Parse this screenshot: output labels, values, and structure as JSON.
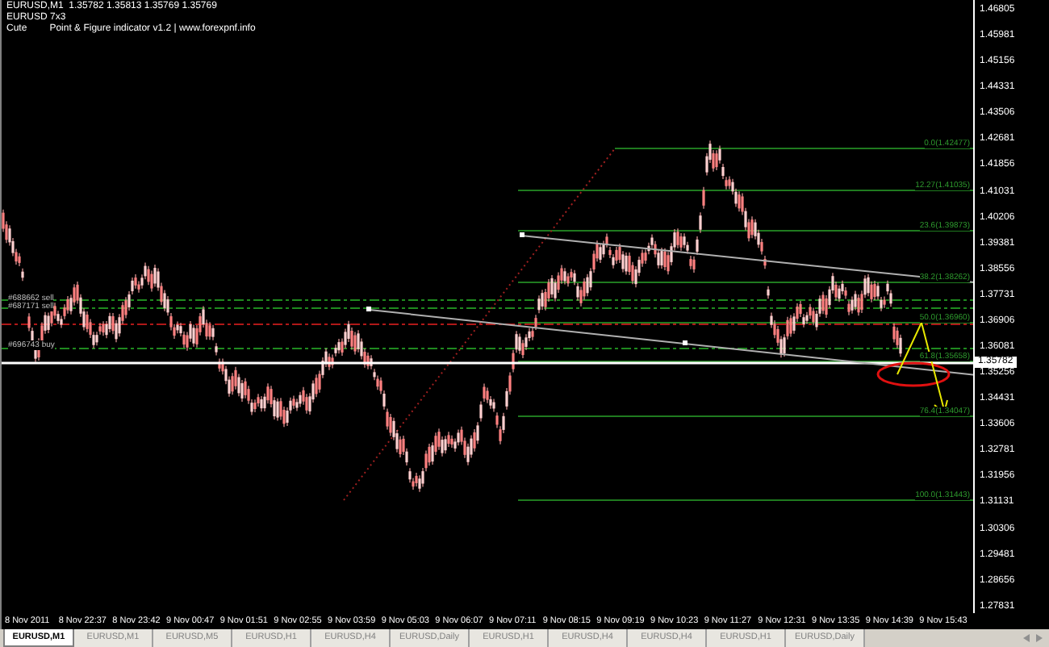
{
  "header": {
    "symbol_line": "EURUSD,M1  1.35782 1.35813 1.35769 1.35769",
    "subtitle": "EURUSD 7x3",
    "indicator_name": "Cute",
    "indicator_info": "Point & Figure indicator v1.2 | www.forexpnf.info"
  },
  "order_labels": [
    "#688662 sell",
    "#687171 sell",
    "#696743 buy"
  ],
  "fib_levels": [
    "0.0(1.42477)",
    "12.27(1.41035)",
    "23.6(1.39873)",
    "38.2(1.38262)",
    "50.0(1.36960)",
    "61.8(1.35658)",
    "76.4(1.34047)",
    "100.0(1.31443)"
  ],
  "price_axis": [
    "1.46805",
    "1.45981",
    "1.45156",
    "1.44331",
    "1.43506",
    "1.42681",
    "1.41856",
    "1.41031",
    "1.40206",
    "1.39381",
    "1.38556",
    "1.37731",
    "1.36906",
    "1.36081",
    "1.35256",
    "1.34431",
    "1.33606",
    "1.32781",
    "1.31956",
    "1.31131",
    "1.30306",
    "1.29481",
    "1.28656",
    "1.27831"
  ],
  "current_price": "1.35782",
  "time_axis": [
    "8 Nov 2011",
    "8 Nov 22:37",
    "8 Nov 23:42",
    "9 Nov 00:47",
    "9 Nov 01:51",
    "9 Nov 02:55",
    "9 Nov 03:59",
    "9 Nov 05:03",
    "9 Nov 06:07",
    "9 Nov 07:11",
    "9 Nov 08:15",
    "9 Nov 09:19",
    "9 Nov 10:23",
    "9 Nov 11:27",
    "9 Nov 12:31",
    "9 Nov 13:35",
    "9 Nov 14:39",
    "9 Nov 15:43"
  ],
  "tabs": [
    {
      "label": "EURUSD,M1",
      "selected": true
    },
    {
      "label": "EURUSD,M1",
      "selected": false
    },
    {
      "label": "EURUSD,M5",
      "selected": false
    },
    {
      "label": "EURUSD,H1",
      "selected": false
    },
    {
      "label": "EURUSD,H4",
      "selected": false
    },
    {
      "label": "EURUSD,Daily",
      "selected": false
    },
    {
      "label": "EURUSD,H1",
      "selected": false
    },
    {
      "label": "EURUSD,H4",
      "selected": false
    },
    {
      "label": "EURUSD,H4",
      "selected": false
    },
    {
      "label": "EURUSD,H1",
      "selected": false
    },
    {
      "label": "EURUSD,Daily",
      "selected": false
    }
  ]
}
